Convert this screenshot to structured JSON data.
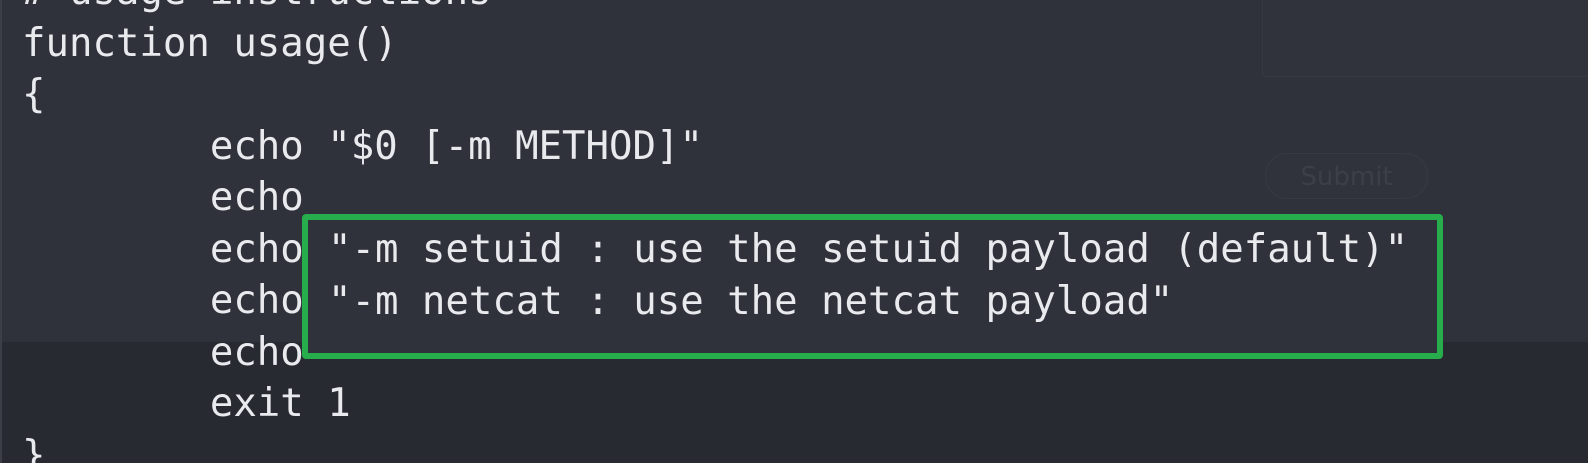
{
  "code": {
    "lines": [
      "# usage instructions",
      "function usage()",
      "{",
      "        echo \"$0 [-m METHOD]\"",
      "        echo",
      "        echo",
      "        echo",
      "        echo",
      "        exit 1",
      "}"
    ]
  },
  "highlight": {
    "lines": [
      "\"-m setuid : use the setuid payload (default)\"",
      "\"-m netcat : use the netcat payload\""
    ],
    "color": "#27ad4b"
  },
  "form": {
    "submit_label": "Submit"
  },
  "colors": {
    "background": "#2f323b",
    "text": "#e9eaee",
    "highlight_border": "#27ad4b"
  }
}
